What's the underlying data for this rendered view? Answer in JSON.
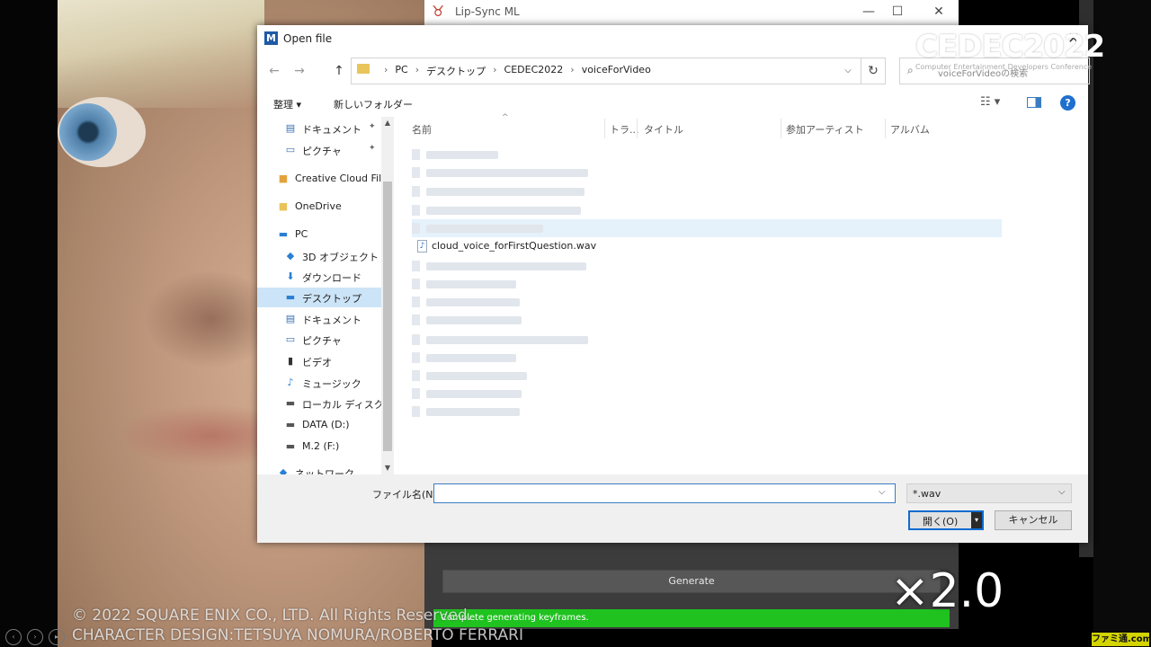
{
  "bg_app": {
    "title": "Lip-Sync ML",
    "generate_label": "Generate",
    "status_text": "Complete generating keyframes.",
    "min_icon": "—",
    "max_icon": "☐",
    "close_icon": "✕"
  },
  "dialog": {
    "app_icon": "M",
    "title": "Open file",
    "close_icon": "✕",
    "nav_back": "←",
    "nav_forward": "→",
    "nav_up": "↑",
    "breadcrumbs": [
      "PC",
      "デスクトップ",
      "CEDEC2022",
      "voiceForVideo"
    ],
    "breadcrumb_sep": "›",
    "refresh": "↻",
    "search_placeholder": "voiceForVideoの検索",
    "toolbar": {
      "organize": "整理 ▾",
      "new_folder": "新しいフォルダー",
      "view": "☷ ▾",
      "help": "?"
    },
    "nav_items": [
      {
        "label": "ドキュメント",
        "icon": "document-icon",
        "glyph": "▤",
        "pin": "✦"
      },
      {
        "label": "ピクチャ",
        "icon": "picture-icon",
        "glyph": "▭",
        "pin": "✦"
      },
      {
        "label": "Creative Cloud Files",
        "icon": "creative-cloud-icon",
        "glyph": "■"
      },
      {
        "label": "OneDrive",
        "icon": "onedrive-icon",
        "glyph": "■"
      },
      {
        "label": "PC",
        "icon": "pc-icon",
        "glyph": "▬"
      },
      {
        "label": "3D オブジェクト",
        "icon": "cube-icon",
        "glyph": "◆"
      },
      {
        "label": "ダウンロード",
        "icon": "download-icon",
        "glyph": "⬇"
      },
      {
        "label": "デスクトップ",
        "icon": "desktop-icon",
        "glyph": "▬"
      },
      {
        "label": "ドキュメント",
        "icon": "document-icon",
        "glyph": "▤"
      },
      {
        "label": "ピクチャ",
        "icon": "picture-icon",
        "glyph": "▭"
      },
      {
        "label": "ビデオ",
        "icon": "video-icon",
        "glyph": "▮"
      },
      {
        "label": "ミュージック",
        "icon": "music-icon",
        "glyph": "♪"
      },
      {
        "label": "ローカル ディスク (C:)",
        "icon": "disk-icon",
        "glyph": "▬"
      },
      {
        "label": "DATA (D:)",
        "icon": "disk-icon",
        "glyph": "▬"
      },
      {
        "label": "M.2 (F:)",
        "icon": "disk-icon",
        "glyph": "▬"
      },
      {
        "label": "ネットワーク",
        "icon": "network-icon",
        "glyph": "◆"
      }
    ],
    "columns": [
      "名前",
      "トラ...",
      "タイトル",
      "参加アーティスト",
      "アルバム"
    ],
    "sort_caret": "^",
    "visible_file": {
      "name": "cloud_voice_forFirstQuestion.wav",
      "icon": "♪"
    },
    "filename_label": "ファイル名(N):",
    "filename_value": "",
    "filetype": "*.wav",
    "dropdown_glyph": "⌵",
    "open_label": "開く(O)",
    "open_split": "▾",
    "cancel_label": "キャンセル"
  },
  "overlay": {
    "cedec_logo": "CEDEC2022",
    "cedec_sub": "Computer Entertainment Developers Conference",
    "speed": "×2.0",
    "copyright_line1": "© 2022 SQUARE ENIX CO., LTD. All Rights Reserved.",
    "copyright_line2": "CHARACTER DESIGN:TETSUYA NOMURA/ROBERTO FERRARI",
    "famitsu": "ファミ通.com",
    "player_controls": [
      "‹",
      "›",
      "▸"
    ]
  },
  "colors": {
    "accent": "#0f6bd0",
    "status_green": "#1fc21f",
    "selection": "#cce4f7"
  }
}
